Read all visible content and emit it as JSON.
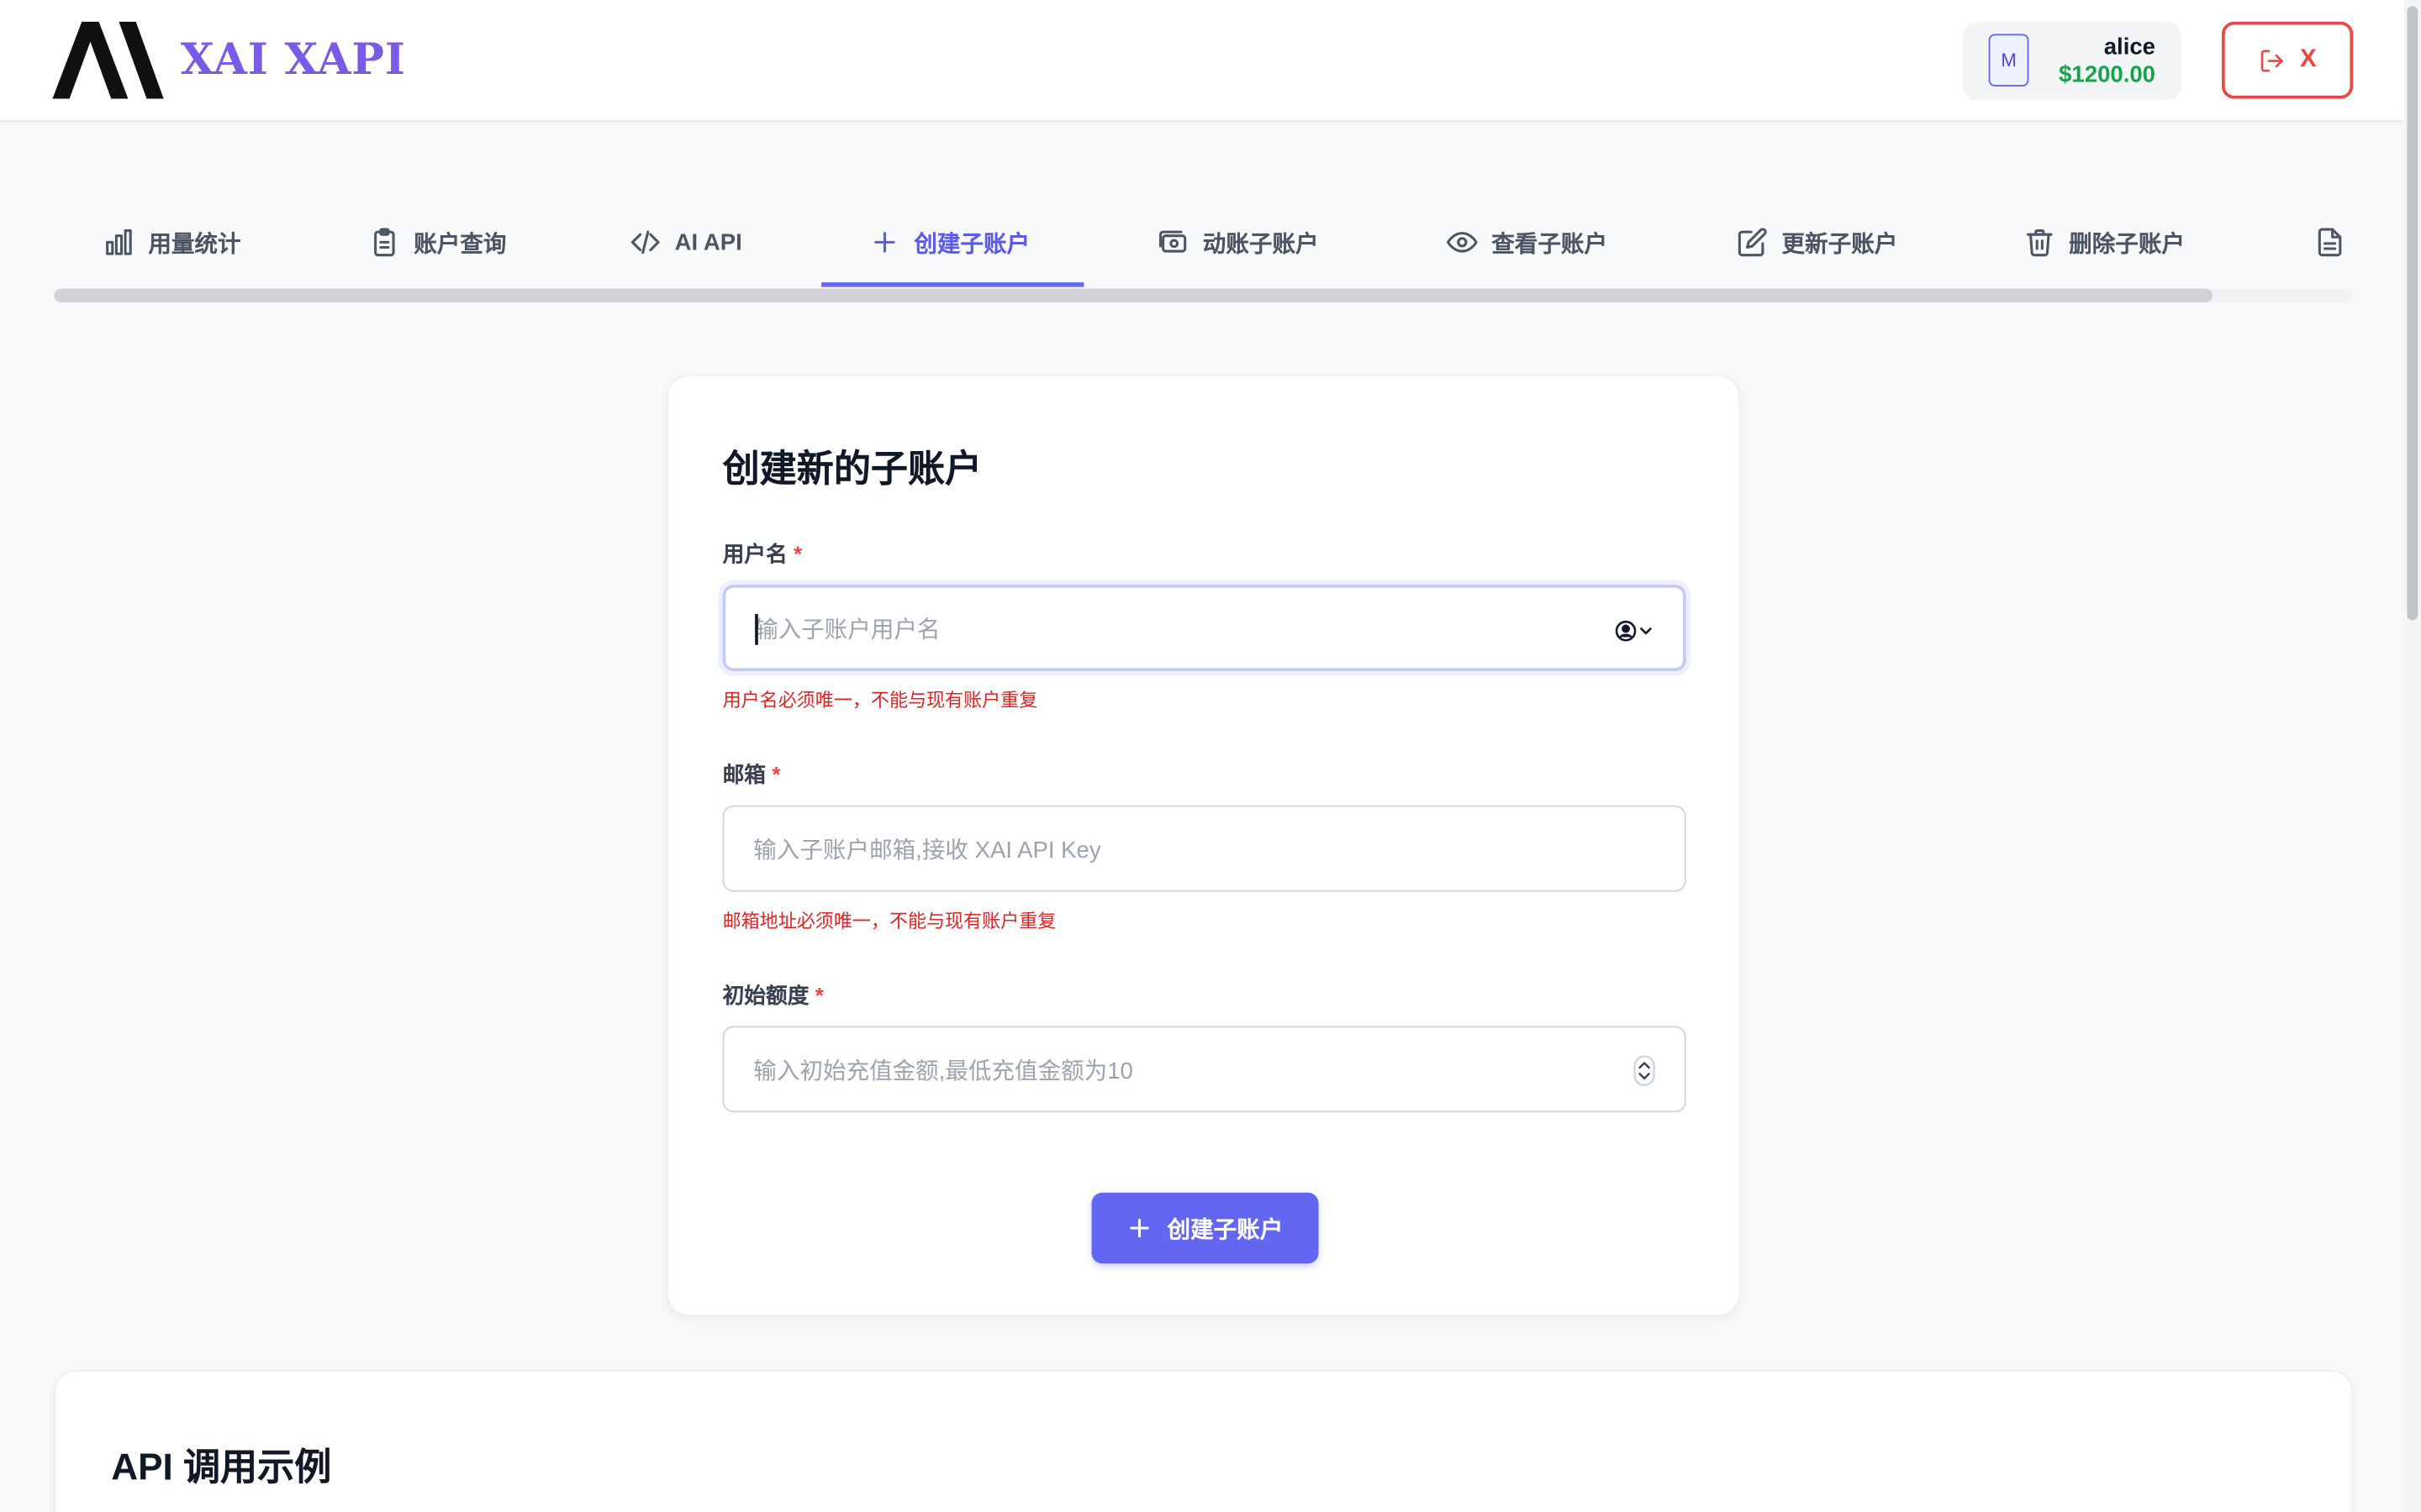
{
  "header": {
    "logo_text": "XAI XAPI",
    "user": {
      "avatar_letter": "M",
      "name": "alice",
      "balance": "$1200.00"
    },
    "logout_label": "X"
  },
  "tabs": [
    {
      "label": "用量统计",
      "icon": "bar-chart-icon"
    },
    {
      "label": "账户查询",
      "icon": "clipboard-icon"
    },
    {
      "label": "AI API",
      "icon": "code-icon"
    },
    {
      "label": "创建子账户",
      "icon": "plus-icon",
      "active": true
    },
    {
      "label": "动账子账户",
      "icon": "money-icon"
    },
    {
      "label": "查看子账户",
      "icon": "eye-icon"
    },
    {
      "label": "更新子账户",
      "icon": "edit-icon"
    },
    {
      "label": "删除子账户",
      "icon": "trash-icon"
    },
    {
      "label": "",
      "icon": "document-icon"
    }
  ],
  "form": {
    "title": "创建新的子账户",
    "username": {
      "label": "用户名",
      "required": "*",
      "placeholder": "输入子账户用户名",
      "hint": "用户名必须唯一，不能与现有账户重复"
    },
    "email": {
      "label": "邮箱",
      "required": "*",
      "placeholder": "输入子账户邮箱,接收 XAI API Key",
      "hint": "邮箱地址必须唯一，不能与现有账户重复"
    },
    "amount": {
      "label": "初始额度",
      "required": "*",
      "placeholder": "输入初始充值金额,最低充值金额为10"
    },
    "submit_label": "创建子账户"
  },
  "api_section": {
    "title": "API 调用示例"
  },
  "colors": {
    "accent": "#6366f1",
    "danger": "#ef4444",
    "success": "#16a34a",
    "brand": "#7b5be6"
  }
}
